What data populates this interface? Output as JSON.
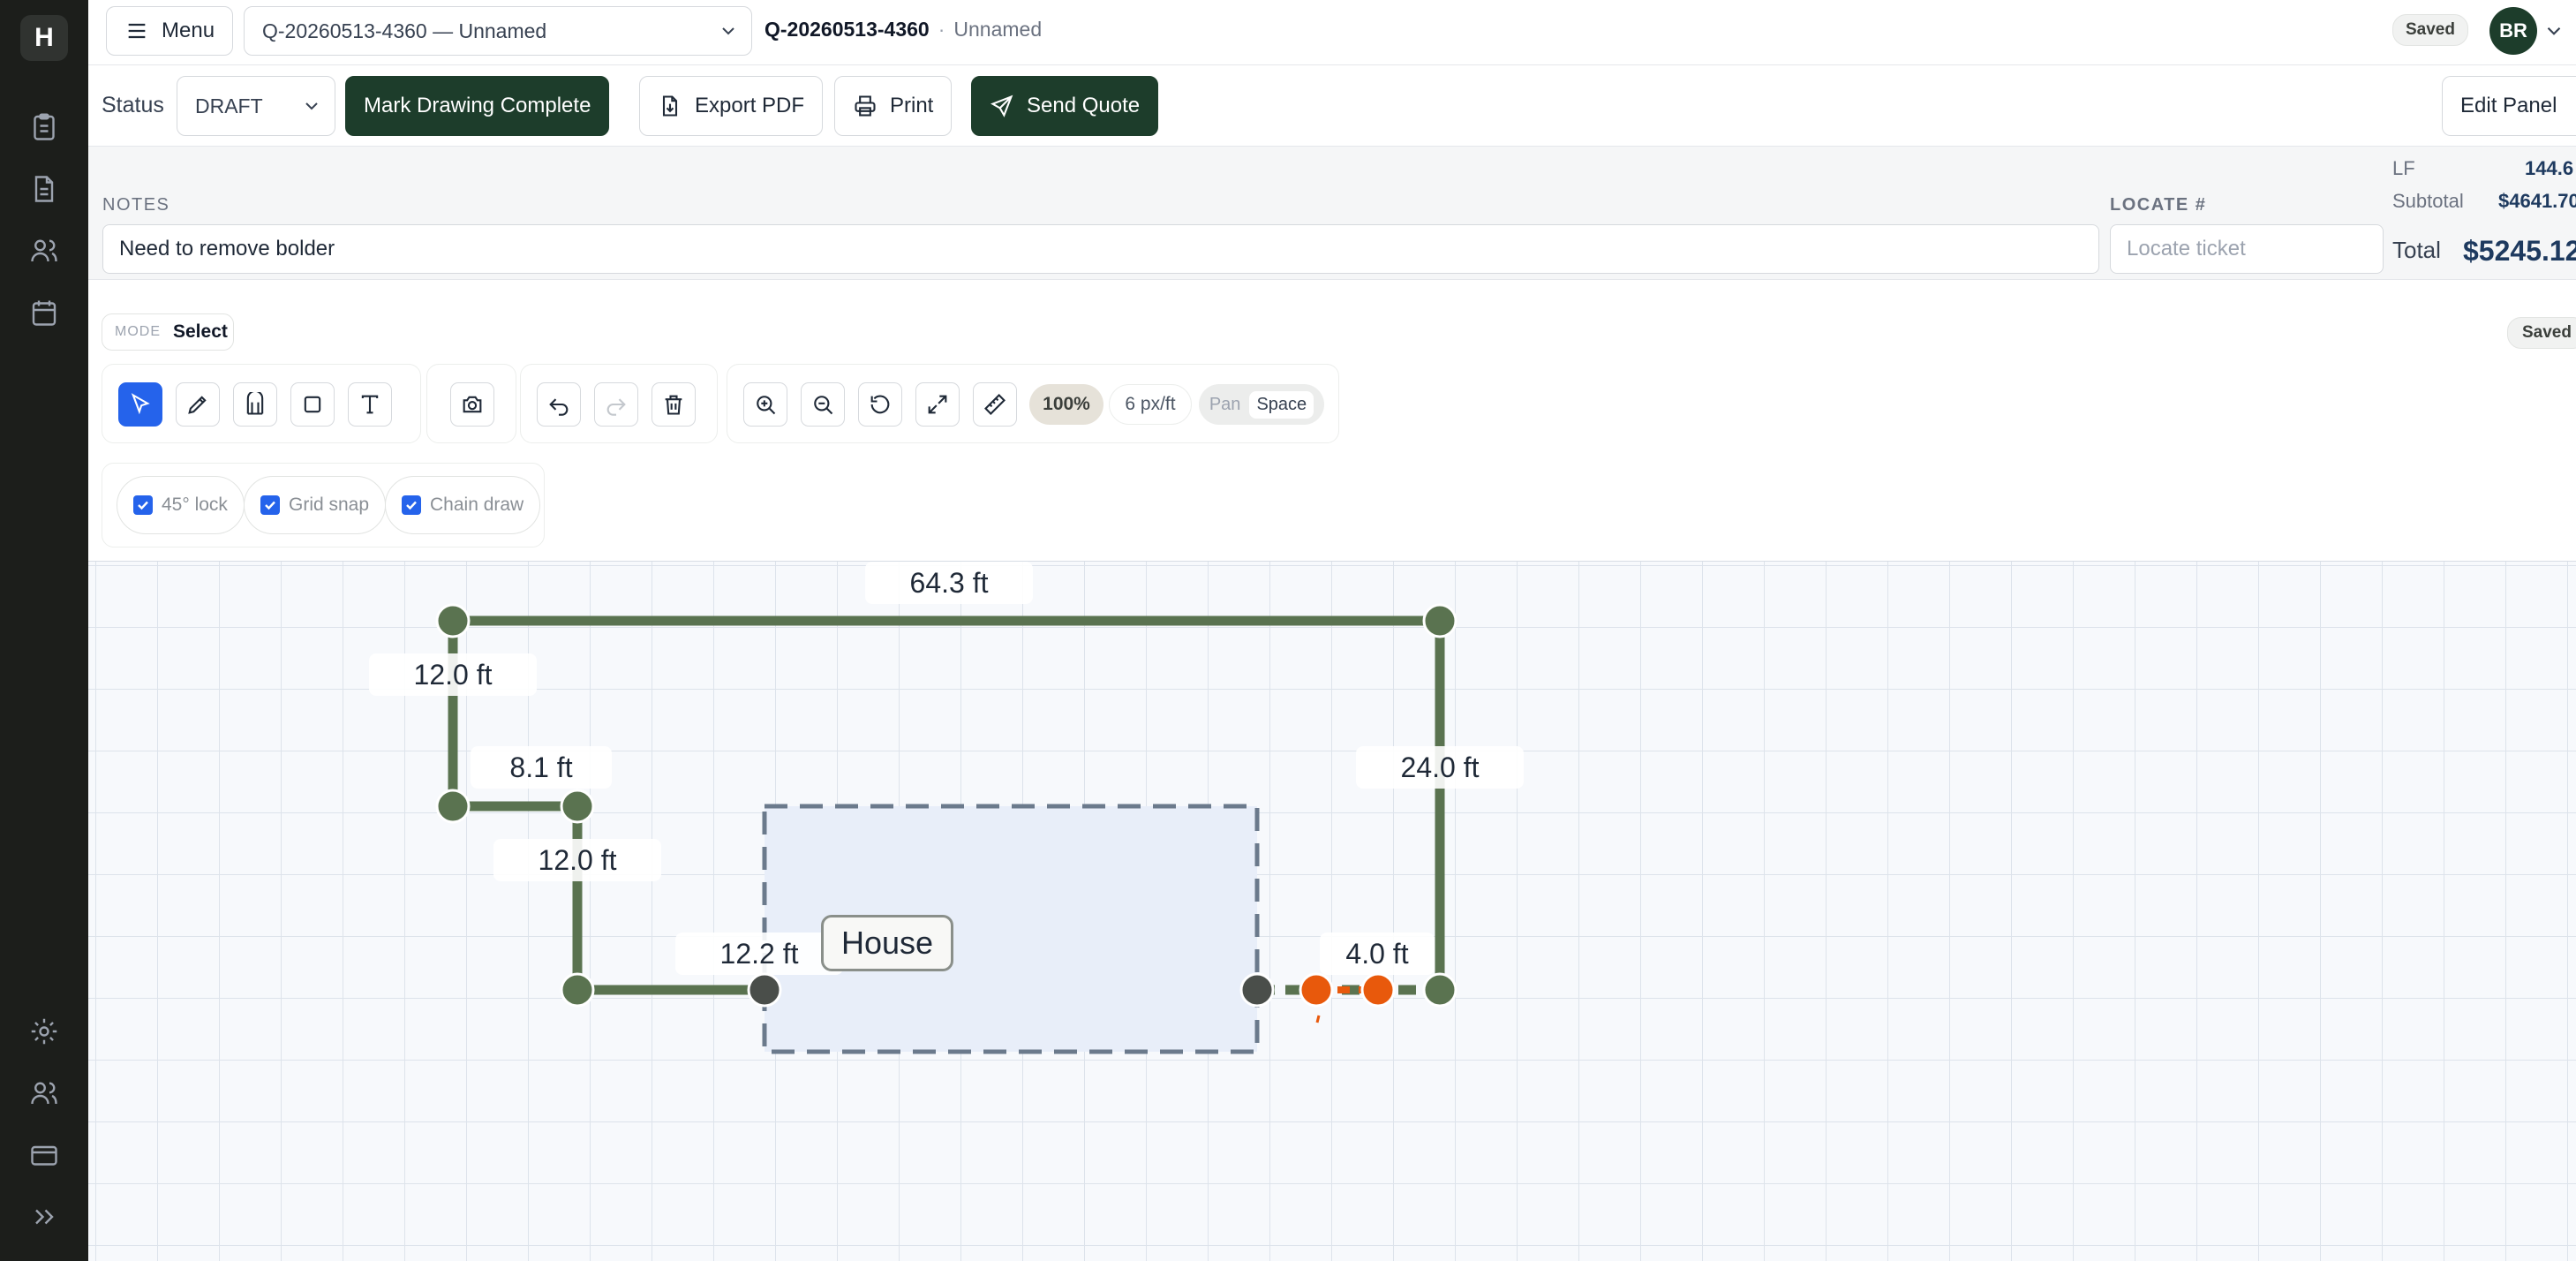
{
  "rail": {
    "logo": "H",
    "icons": [
      "clipboard-icon",
      "document-icon",
      "users-icon",
      "calendar-icon",
      "settings-icon",
      "team-icon",
      "billing-card-icon",
      "expand-icon"
    ]
  },
  "topbar": {
    "menu_label": "Menu",
    "quote_select": "Q-20260513-4360 — Unnamed",
    "quote_id": "Q-20260513-4360",
    "separator": "·",
    "quote_name": "Unnamed",
    "saved_badge": "Saved",
    "avatar_initials": "BR"
  },
  "actions": {
    "status_label": "Status",
    "status_value": "DRAFT",
    "mark_complete": "Mark Drawing Complete",
    "export_pdf": "Export PDF",
    "print": "Print",
    "send_quote": "Send Quote",
    "edit_panel": "Edit Panel"
  },
  "notes": {
    "label": "NOTES",
    "value": "Need to remove bolder",
    "locate_label": "LOCATE #",
    "locate_placeholder": "Locate ticket"
  },
  "totals": {
    "lf_label": "LF",
    "lf_value": "144.6",
    "subtotal_label": "Subtotal",
    "subtotal_value": "$4641.70",
    "total_label": "Total",
    "total_value": "$5245.12"
  },
  "toolbar": {
    "mode_label": "MODE",
    "mode_value": "Select",
    "saved": "Saved",
    "zoom": "100%",
    "scale": "6 px/ft",
    "pan_label": "Pan",
    "pan_key": "Space",
    "toggles": [
      {
        "label": "45° lock",
        "checked": true
      },
      {
        "label": "Grid snap",
        "checked": true
      },
      {
        "label": "Chain draw",
        "checked": true
      }
    ]
  },
  "drawing": {
    "house_label": "House",
    "segments": [
      {
        "label": "64.3 ft"
      },
      {
        "label": "12.0 ft"
      },
      {
        "label": "24.0 ft"
      },
      {
        "label": "8.1 ft"
      },
      {
        "label": "12.0 ft"
      },
      {
        "label": "12.2 ft"
      },
      {
        "label": "4.0 ft"
      }
    ],
    "colors": {
      "fence": "#5a7350",
      "node": "#5a7350",
      "gate_node": "#4a4e4a",
      "selected": "#e8590c",
      "house_fill": "#e8eef9",
      "house_stroke": "#6b7a8c"
    }
  }
}
